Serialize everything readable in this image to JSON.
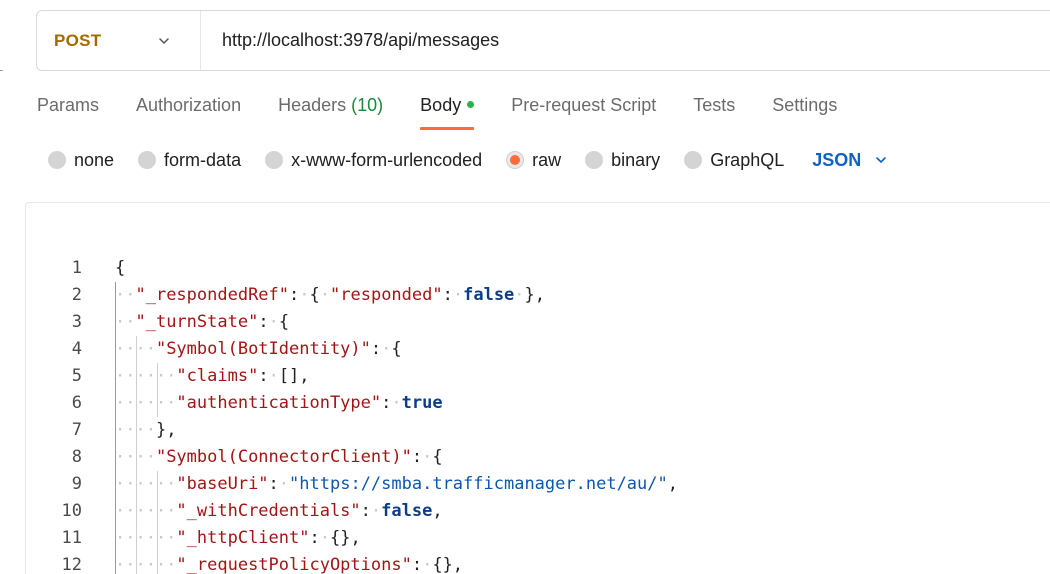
{
  "request": {
    "method": "POST",
    "url": "http://localhost:3978/api/messages"
  },
  "tabs": [
    {
      "label": "Params"
    },
    {
      "label": "Authorization"
    },
    {
      "label": "Headers",
      "count": "(10)"
    },
    {
      "label": "Body",
      "active": true
    },
    {
      "label": "Pre-request Script"
    },
    {
      "label": "Tests"
    },
    {
      "label": "Settings"
    }
  ],
  "body_types": [
    {
      "label": "none",
      "checked": false
    },
    {
      "label": "form-data",
      "checked": false
    },
    {
      "label": "x-www-form-urlencoded",
      "checked": false
    },
    {
      "label": "raw",
      "checked": true
    },
    {
      "label": "binary",
      "checked": false
    },
    {
      "label": "GraphQL",
      "checked": false
    }
  ],
  "format": "JSON",
  "editor": {
    "lines": [
      {
        "n": "1",
        "indent": 0,
        "tokens": [
          [
            "p",
            "{"
          ]
        ]
      },
      {
        "n": "2",
        "indent": 1,
        "tokens": [
          [
            "k",
            "\"_respondedRef\""
          ],
          [
            "p",
            ":"
          ],
          [
            "w",
            "·"
          ],
          [
            "p",
            "{"
          ],
          [
            "w",
            "·"
          ],
          [
            "k",
            "\"responded\""
          ],
          [
            "p",
            ":"
          ],
          [
            "w",
            "·"
          ],
          [
            "b",
            "false"
          ],
          [
            "w",
            "·"
          ],
          [
            "p",
            "},"
          ]
        ]
      },
      {
        "n": "3",
        "indent": 1,
        "tokens": [
          [
            "k",
            "\"_turnState\""
          ],
          [
            "p",
            ":"
          ],
          [
            "w",
            "·"
          ],
          [
            "p",
            "{"
          ]
        ]
      },
      {
        "n": "4",
        "indent": 2,
        "tokens": [
          [
            "k",
            "\"Symbol(BotIdentity)\""
          ],
          [
            "p",
            ":"
          ],
          [
            "w",
            "·"
          ],
          [
            "p",
            "{"
          ]
        ]
      },
      {
        "n": "5",
        "indent": 3,
        "tokens": [
          [
            "k",
            "\"claims\""
          ],
          [
            "p",
            ":"
          ],
          [
            "w",
            "·"
          ],
          [
            "p",
            "[],"
          ]
        ]
      },
      {
        "n": "6",
        "indent": 3,
        "tokens": [
          [
            "k",
            "\"authenticationType\""
          ],
          [
            "p",
            ":"
          ],
          [
            "w",
            "·"
          ],
          [
            "b",
            "true"
          ]
        ]
      },
      {
        "n": "7",
        "indent": 2,
        "tokens": [
          [
            "p",
            "},"
          ]
        ]
      },
      {
        "n": "8",
        "indent": 2,
        "tokens": [
          [
            "k",
            "\"Symbol(ConnectorClient)\""
          ],
          [
            "p",
            ":"
          ],
          [
            "w",
            "·"
          ],
          [
            "p",
            "{"
          ]
        ]
      },
      {
        "n": "9",
        "indent": 3,
        "tokens": [
          [
            "k",
            "\"baseUri\""
          ],
          [
            "p",
            ":"
          ],
          [
            "w",
            "·"
          ],
          [
            "s",
            "\"https://smba.trafficmanager.net/au/\""
          ],
          [
            "p",
            ","
          ]
        ]
      },
      {
        "n": "10",
        "indent": 3,
        "tokens": [
          [
            "k",
            "\"_withCredentials\""
          ],
          [
            "p",
            ":"
          ],
          [
            "w",
            "·"
          ],
          [
            "b",
            "false"
          ],
          [
            "p",
            ","
          ]
        ]
      },
      {
        "n": "11",
        "indent": 3,
        "tokens": [
          [
            "k",
            "\"_httpClient\""
          ],
          [
            "p",
            ":"
          ],
          [
            "w",
            "·"
          ],
          [
            "p",
            "{},"
          ]
        ]
      },
      {
        "n": "12",
        "indent": 3,
        "tokens": [
          [
            "k",
            "\"_requestPolicyOptions\""
          ],
          [
            "p",
            ":"
          ],
          [
            "w",
            "·"
          ],
          [
            "p",
            "{},"
          ]
        ]
      }
    ]
  },
  "colors": {
    "accent": "#ff6c37",
    "method": "#a46a00",
    "json_link": "#0f62c4",
    "active_dot": "#2bb34a"
  }
}
